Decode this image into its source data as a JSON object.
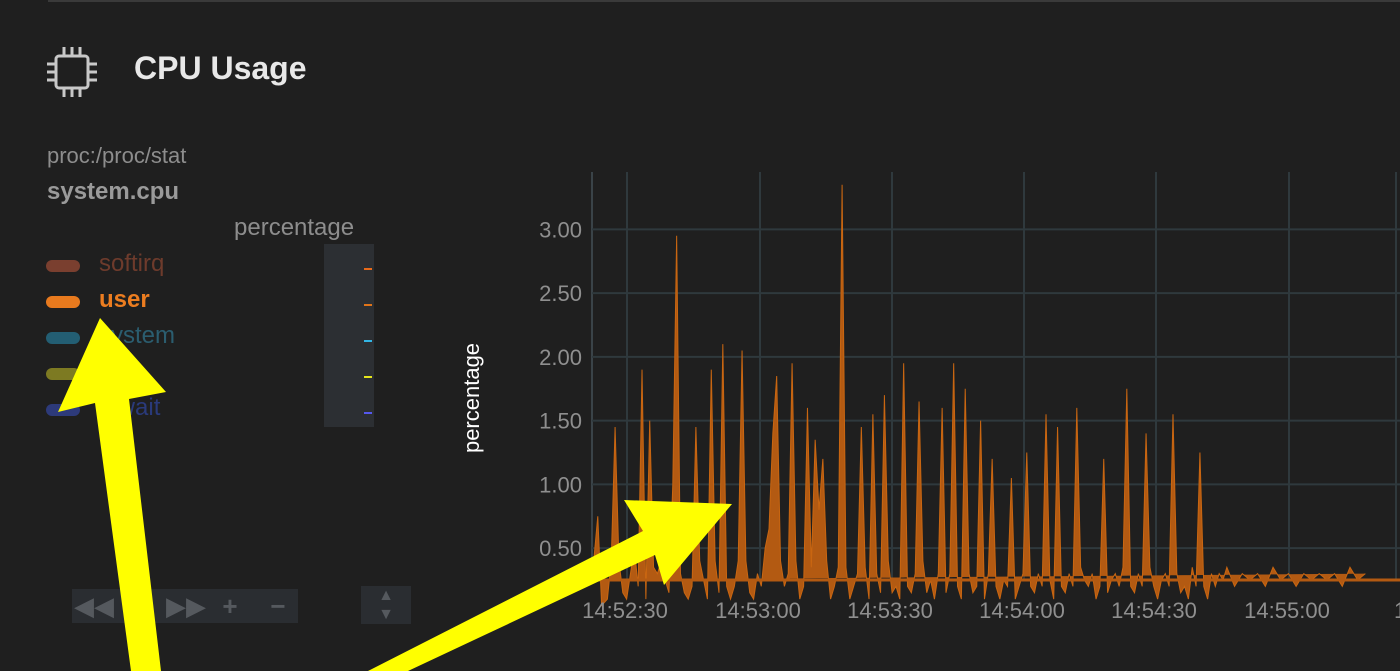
{
  "header": {
    "title": "CPU Usage",
    "icon": "cpu-chip-icon"
  },
  "chart_info": {
    "context": "proc:/proc/stat",
    "family": "system.cpu",
    "units": "percentage"
  },
  "legend": {
    "dimensions": [
      {
        "name": "softirq",
        "color": "#7a3f2f",
        "text_color": "#6e3b2c",
        "selected": false
      },
      {
        "name": "user",
        "color": "#e87a1e",
        "text_color": "#ec7d20",
        "selected": true
      },
      {
        "name": "system",
        "color": "#235e73",
        "text_color": "#2b5d6f",
        "selected": false
      },
      {
        "name": "nice",
        "color": "#7d7a22",
        "text_color": "#6c6a22",
        "selected": false
      },
      {
        "name": "iowait",
        "color": "#2d3a7a",
        "text_color": "#2a3a7b",
        "selected": false
      }
    ],
    "value_colors": [
      "#e86a1a",
      "#e07419",
      "#33b5e5",
      "#e5e51c",
      "#5558ee"
    ]
  },
  "toolbar": {
    "buttons": [
      {
        "name": "rewind-icon",
        "glyph": "◀◀"
      },
      {
        "name": "pan-left-icon",
        "glyph": "◀"
      },
      {
        "name": "pan-right-icon",
        "glyph": "▶▶"
      },
      {
        "name": "zoom-in-icon",
        "glyph": "+"
      },
      {
        "name": "zoom-out-icon",
        "glyph": "−"
      }
    ],
    "resize_icon": "resize-handle-icon"
  },
  "chart_data": {
    "type": "area",
    "ylabel": "percentage",
    "xlabel": "",
    "title": "",
    "series": [
      {
        "name": "user",
        "color": "#b35a12",
        "x_seconds": [
          0,
          3,
          5,
          8,
          10,
          12,
          14,
          16,
          18,
          20,
          22,
          24,
          26,
          28,
          30,
          32,
          34,
          36,
          38,
          40,
          42,
          44,
          46,
          48,
          50,
          52,
          54,
          56,
          58,
          60,
          62,
          64,
          66,
          68,
          70,
          72,
          74,
          76,
          78,
          80,
          82,
          84,
          86,
          88,
          90,
          92,
          94,
          96,
          98,
          100,
          102,
          104,
          106,
          108,
          110,
          112,
          114,
          116,
          118,
          120,
          122,
          124,
          126,
          128,
          130,
          132,
          134,
          136,
          138,
          140,
          142,
          144,
          146,
          148,
          150,
          152,
          154,
          156,
          158,
          160,
          162,
          164,
          166,
          168,
          170,
          172,
          174,
          176,
          178,
          180,
          182,
          184,
          186,
          188,
          190,
          192,
          194,
          196,
          198,
          200,
          202,
          204,
          206,
          208,
          210,
          212,
          214,
          216,
          218,
          220,
          222,
          224,
          226,
          228,
          230,
          232,
          234,
          236,
          238,
          240,
          242,
          244,
          246,
          248,
          250,
          252,
          254,
          256,
          258,
          260,
          262,
          264,
          266,
          268,
          270,
          272,
          274,
          276,
          278,
          280,
          282,
          284,
          286,
          288,
          290,
          292,
          294,
          296,
          298,
          300,
          302,
          304,
          306,
          308,
          310,
          312,
          314,
          316,
          318,
          320,
          322,
          324,
          326,
          328,
          330,
          334,
          338,
          342,
          346,
          350,
          354,
          358,
          362,
          366,
          370,
          374,
          378,
          382,
          386,
          390,
          394,
          398,
          402,
          406,
          410,
          414,
          418,
          420
        ],
        "values": [
          0.25,
          0.75,
          0.05,
          0.1,
          0.4,
          1.45,
          0.4,
          0.15,
          0.1,
          0.3,
          0.5,
          0.2,
          1.9,
          0.1,
          1.5,
          0.35,
          0.3,
          0.4,
          0.25,
          0.15,
          1.0,
          2.95,
          0.3,
          0.15,
          0.1,
          0.2,
          1.45,
          0.4,
          0.25,
          0.1,
          1.9,
          0.4,
          0.15,
          2.1,
          0.2,
          0.1,
          0.2,
          0.4,
          2.05,
          0.4,
          0.15,
          0.1,
          0.3,
          0.2,
          0.5,
          0.65,
          1.4,
          1.85,
          0.4,
          0.2,
          0.3,
          1.95,
          0.4,
          0.1,
          0.2,
          1.6,
          0.35,
          1.35,
          0.8,
          1.2,
          0.4,
          0.1,
          0.2,
          0.35,
          3.35,
          0.35,
          0.1,
          0.2,
          0.3,
          1.45,
          0.35,
          0.1,
          1.55,
          0.3,
          0.15,
          1.7,
          0.4,
          0.15,
          0.2,
          0.1,
          1.95,
          0.2,
          0.15,
          0.3,
          1.65,
          0.4,
          0.15,
          0.25,
          0.1,
          0.3,
          1.6,
          0.15,
          0.3,
          1.95,
          0.2,
          0.1,
          1.75,
          0.3,
          0.15,
          0.2,
          1.5,
          0.1,
          0.3,
          1.2,
          0.2,
          0.1,
          0.25,
          0.2,
          1.05,
          0.1,
          0.2,
          0.3,
          1.25,
          0.2,
          0.15,
          0.3,
          0.2,
          1.55,
          0.25,
          0.1,
          1.45,
          0.2,
          0.15,
          0.3,
          0.2,
          1.6,
          0.35,
          0.25,
          0.2,
          0.3,
          0.1,
          0.2,
          1.2,
          0.15,
          0.25,
          0.3,
          0.2,
          0.35,
          1.75,
          0.2,
          0.15,
          0.3,
          0.2,
          1.4,
          0.35,
          0.2,
          0.1,
          0.25,
          0.3,
          0.2,
          1.55,
          0.3,
          0.15,
          0.2,
          0.1,
          0.35,
          0.2,
          1.25,
          0.2,
          0.1,
          0.3,
          0.2,
          0.3,
          0.25,
          0.35,
          0.2,
          0.3,
          0.25,
          0.3,
          0.2,
          0.35,
          0.25,
          0.3,
          0.2,
          0.3,
          0.25,
          0.3,
          0.25,
          0.3,
          0.2,
          0.35,
          0.25,
          0.3
        ]
      }
    ],
    "x_tick_labels": [
      "14:52:30",
      "14:53:00",
      "14:53:30",
      "14:54:00",
      "14:54:30",
      "14:55:00",
      "14"
    ],
    "y_tick_labels": [
      "0.50",
      "1.00",
      "1.50",
      "2.00",
      "2.50",
      "3.00"
    ],
    "y_ticks": [
      0.5,
      1.0,
      1.5,
      2.0,
      2.5,
      3.0
    ],
    "ylim": [
      0.25,
      3.45
    ],
    "grid": true
  },
  "annotations": [
    {
      "type": "arrow",
      "color": "#ffff00",
      "target": "user legend entry"
    },
    {
      "type": "arrow",
      "color": "#ffff00",
      "target": "chart area"
    }
  ]
}
